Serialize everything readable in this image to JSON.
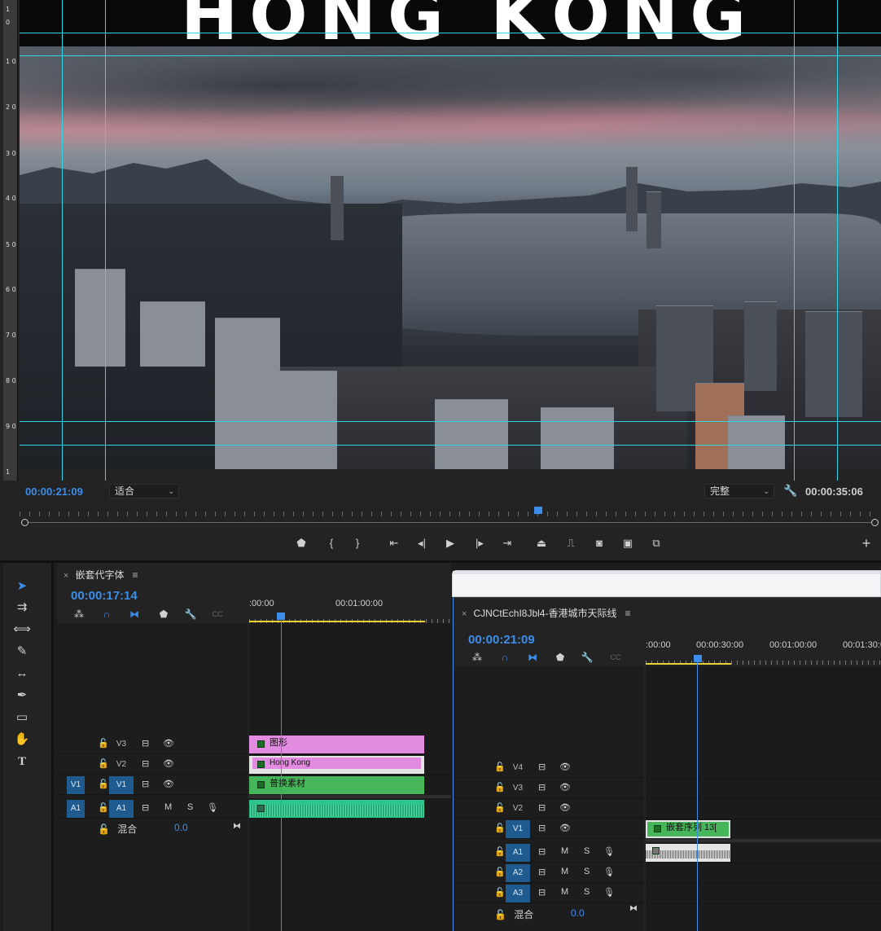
{
  "program_monitor": {
    "overlay_title": "HONG KONG",
    "current_timecode": "00:00:21:09",
    "zoom": "适合",
    "quality": "完整",
    "duration": "00:00:35:06",
    "ruler_marks": [
      "1",
      "0",
      "1 0",
      "2 0",
      "3 0",
      "4 0",
      "5 0",
      "6 0",
      "7 0",
      "8 0",
      "9 0",
      "1"
    ]
  },
  "tools": [
    "selection-tool",
    "track-select-tool",
    "ripple-edit-tool",
    "razor-tool",
    "slip-tool",
    "pen-tool",
    "rectangle-tool",
    "hand-tool",
    "type-tool"
  ],
  "timeline_left": {
    "tab_title": "嵌套代字体",
    "timecode": "00:00:17:14",
    "ruler": [
      ":00:00",
      "00:01:00:00"
    ],
    "tracks": [
      {
        "name": "V3",
        "target": ""
      },
      {
        "name": "V2",
        "target": ""
      },
      {
        "name": "V1",
        "target": "V1"
      },
      {
        "name": "A1",
        "target": "A1"
      }
    ],
    "audio_buttons": {
      "mute": "M",
      "solo": "S"
    },
    "clips": {
      "v3": "图形",
      "v2": "Hong Kong",
      "v1": "普换素材"
    },
    "mix_label": "混合",
    "mix_value": "0.0"
  },
  "timeline_right": {
    "tab_title": "CJNCtEchI8Jbl4-香港城市天际线",
    "timecode": "00:00:21:09",
    "ruler": [
      ":00:00",
      "00:00:30:00",
      "00:01:00:00",
      "00:01:30:0"
    ],
    "video_tracks": [
      "V4",
      "V3",
      "V2",
      "V1"
    ],
    "audio_tracks": [
      "A1",
      "A2",
      "A3"
    ],
    "audio_buttons": {
      "mute": "M",
      "solo": "S"
    },
    "clips": {
      "v1": "嵌套序列 13["
    },
    "mix_label": "混合",
    "mix_value": "0.0"
  }
}
